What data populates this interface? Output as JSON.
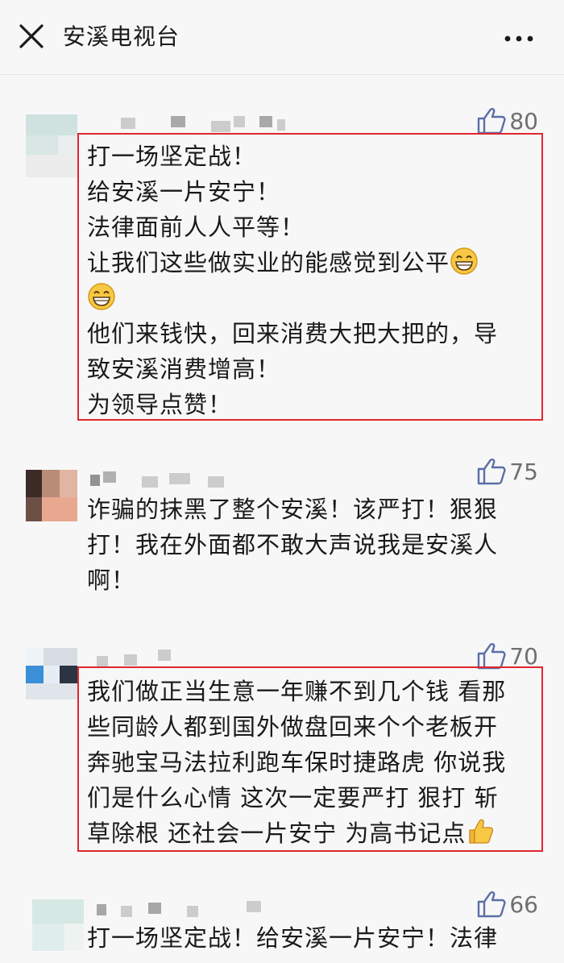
{
  "header": {
    "title": "安溪电视台"
  },
  "comments": [
    {
      "likes": "80",
      "lines": [
        "打一场坚定战！",
        "给安溪一片安宁！",
        "法律面前人人平等！",
        "让我们这些做实业的能感觉到公平",
        "",
        "他们来钱快，回来消费大把大把的，导",
        "致安溪消费增高！",
        "为领导点赞！"
      ]
    },
    {
      "likes": "75",
      "lines": [
        "诈骗的抹黑了整个安溪！该严打！狠狠",
        "打！我在外面都不敢大声说我是安溪人",
        "啊！"
      ]
    },
    {
      "likes": "70",
      "lines": [
        "我们做正当生意一年赚不到几个钱 看那",
        "些同龄人都到国外做盘回来个个老板开",
        "奔驰宝马法拉利跑车保时捷路虎 你说我",
        "们是什么心情 这次一定要严打 狠打 斩",
        "草除根 还社会一片安宁 为高书记点"
      ]
    },
    {
      "likes": "66",
      "lines": [
        "打一场坚定战！给安溪一片安宁！法律"
      ]
    }
  ],
  "icons": {
    "close": "close-icon",
    "more": "more-icon",
    "like": "thumbs-up-icon",
    "grin": "grinning-emoji-icon",
    "thumb_emoji": "thumbs-up-emoji-icon"
  },
  "colors": {
    "highlight_border": "#e0262e",
    "like_icon": "#5b6ea8",
    "like_count": "#6f6f6f"
  }
}
